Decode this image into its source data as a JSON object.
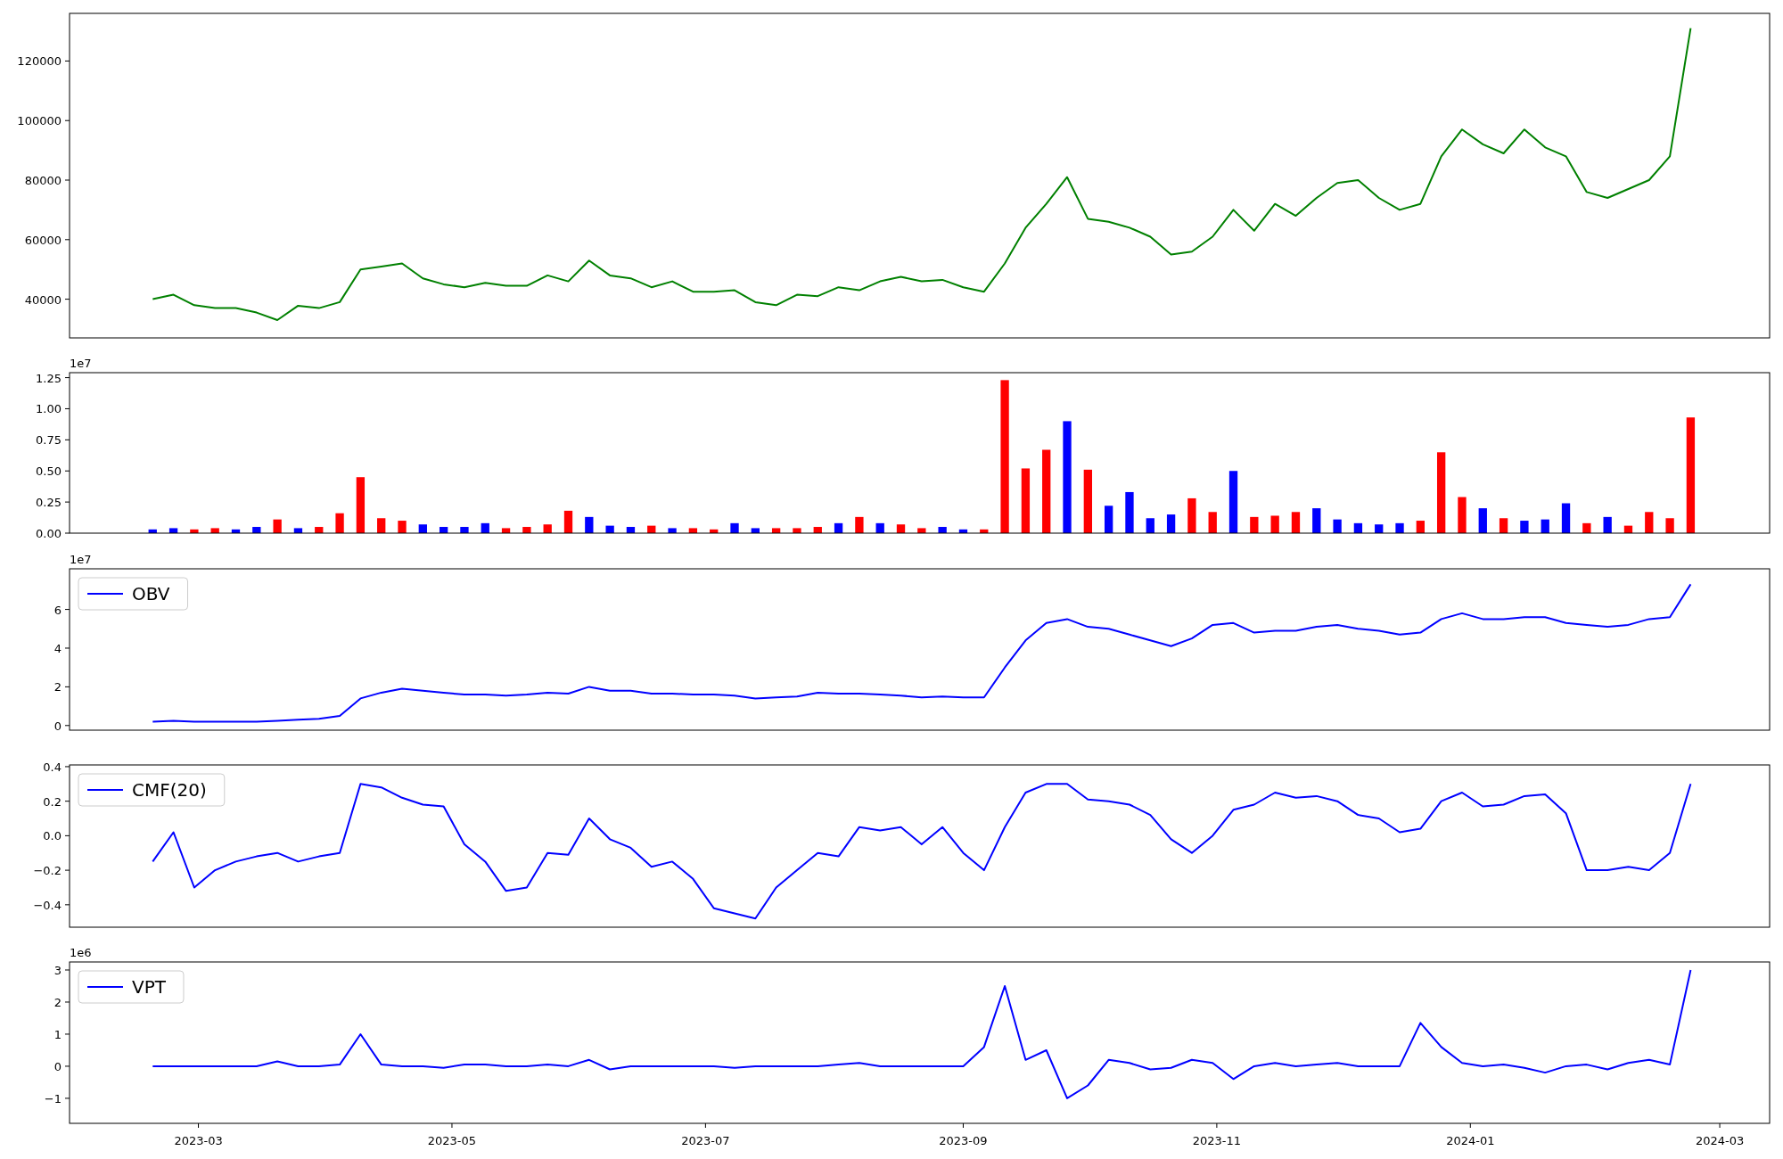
{
  "figure": {
    "panels": [
      {
        "chart_data": {
          "type": "line",
          "x": [
            "2023-02-18",
            "2023-02-23",
            "2023-02-28",
            "2023-03-05",
            "2023-03-10",
            "2023-03-15",
            "2023-03-20",
            "2023-03-25",
            "2023-03-30",
            "2023-04-04",
            "2023-04-09",
            "2023-04-14",
            "2023-04-19",
            "2023-04-24",
            "2023-04-29",
            "2023-05-04",
            "2023-05-09",
            "2023-05-14",
            "2023-05-19",
            "2023-05-24",
            "2023-05-29",
            "2023-06-03",
            "2023-06-08",
            "2023-06-13",
            "2023-06-18",
            "2023-06-23",
            "2023-06-28",
            "2023-07-03",
            "2023-07-08",
            "2023-07-13",
            "2023-07-18",
            "2023-07-23",
            "2023-07-28",
            "2023-08-02",
            "2023-08-07",
            "2023-08-12",
            "2023-08-17",
            "2023-08-22",
            "2023-08-27",
            "2023-09-01",
            "2023-09-06",
            "2023-09-11",
            "2023-09-16",
            "2023-09-21",
            "2023-09-26",
            "2023-10-01",
            "2023-10-06",
            "2023-10-11",
            "2023-10-16",
            "2023-10-21",
            "2023-10-26",
            "2023-10-31",
            "2023-11-05",
            "2023-11-10",
            "2023-11-15",
            "2023-11-20",
            "2023-11-25",
            "2023-11-30",
            "2023-12-05",
            "2023-12-10",
            "2023-12-15",
            "2023-12-20",
            "2023-12-25",
            "2023-12-30",
            "2024-01-04",
            "2024-01-09",
            "2024-01-14",
            "2024-01-19",
            "2024-01-24",
            "2024-01-29",
            "2024-02-03",
            "2024-02-08",
            "2024-02-13",
            "2024-02-18",
            "2024-02-23"
          ],
          "series": [
            {
              "color": "#008000",
              "values": [
                40000,
                41500,
                38000,
                37000,
                37000,
                35500,
                33000,
                37800,
                37000,
                39000,
                50000,
                51000,
                52000,
                47000,
                45000,
                44000,
                45500,
                44500,
                44500,
                48000,
                46000,
                53000,
                48000,
                47000,
                44000,
                46000,
                42500,
                42500,
                43000,
                39000,
                38000,
                41500,
                41000,
                44000,
                43000,
                46000,
                47500,
                46000,
                46500,
                44000,
                42500,
                52000,
                64000,
                72000,
                81000,
                67000,
                66000,
                64000,
                61000,
                55000,
                56000,
                61000,
                70000,
                63000,
                72000,
                68000,
                74000,
                79000,
                80000,
                74000,
                70000,
                72000,
                88000,
                97000,
                92000,
                89000,
                97000,
                91000,
                88000,
                76000,
                74000,
                77000,
                80000,
                88000,
                131000
              ]
            }
          ],
          "xlim": [
            "2023-01-29",
            "2024-03-13"
          ],
          "ylim": [
            27000,
            136000
          ],
          "yticks": [
            40000,
            60000,
            80000,
            100000,
            120000
          ]
        }
      },
      {
        "offset_text": "1e7",
        "chart_data": {
          "type": "bar",
          "x": [
            "2023-02-18",
            "2023-02-23",
            "2023-02-28",
            "2023-03-05",
            "2023-03-10",
            "2023-03-15",
            "2023-03-20",
            "2023-03-25",
            "2023-03-30",
            "2023-04-04",
            "2023-04-09",
            "2023-04-14",
            "2023-04-19",
            "2023-04-24",
            "2023-04-29",
            "2023-05-04",
            "2023-05-09",
            "2023-05-14",
            "2023-05-19",
            "2023-05-24",
            "2023-05-29",
            "2023-06-03",
            "2023-06-08",
            "2023-06-13",
            "2023-06-18",
            "2023-06-23",
            "2023-06-28",
            "2023-07-03",
            "2023-07-08",
            "2023-07-13",
            "2023-07-18",
            "2023-07-23",
            "2023-07-28",
            "2023-08-02",
            "2023-08-07",
            "2023-08-12",
            "2023-08-17",
            "2023-08-22",
            "2023-08-27",
            "2023-09-01",
            "2023-09-06",
            "2023-09-11",
            "2023-09-16",
            "2023-09-21",
            "2023-09-26",
            "2023-10-01",
            "2023-10-06",
            "2023-10-11",
            "2023-10-16",
            "2023-10-21",
            "2023-10-26",
            "2023-10-31",
            "2023-11-05",
            "2023-11-10",
            "2023-11-15",
            "2023-11-20",
            "2023-11-25",
            "2023-11-30",
            "2023-12-05",
            "2023-12-10",
            "2023-12-15",
            "2023-12-20",
            "2023-12-25",
            "2023-12-30",
            "2024-01-04",
            "2024-01-09",
            "2024-01-14",
            "2024-01-19",
            "2024-01-24",
            "2024-01-29",
            "2024-02-03",
            "2024-02-08",
            "2024-02-13",
            "2024-02-18",
            "2024-02-23"
          ],
          "series": [
            {
              "color": "#ff0000",
              "values": [
                null,
                null,
                0.03,
                0.04,
                null,
                null,
                0.11,
                null,
                0.05,
                0.16,
                0.45,
                0.12,
                0.1,
                null,
                null,
                null,
                null,
                0.04,
                0.05,
                0.07,
                0.18,
                null,
                null,
                null,
                0.06,
                null,
                0.04,
                0.03,
                null,
                null,
                0.04,
                0.04,
                0.05,
                null,
                0.13,
                null,
                0.07,
                0.04,
                null,
                null,
                0.03,
                1.23,
                0.52,
                0.67,
                null,
                0.51,
                null,
                null,
                null,
                null,
                0.28,
                0.17,
                null,
                0.13,
                0.14,
                0.17,
                null,
                null,
                null,
                null,
                null,
                0.1,
                0.65,
                0.29,
                null,
                0.12,
                null,
                null,
                null,
                0.08,
                null,
                0.06,
                0.17,
                0.12,
                0.93
              ]
            },
            {
              "color": "#0000ff",
              "values": [
                0.03,
                0.04,
                null,
                null,
                0.03,
                0.05,
                null,
                0.04,
                null,
                null,
                null,
                null,
                null,
                0.07,
                0.05,
                0.05,
                0.08,
                null,
                null,
                null,
                null,
                0.13,
                0.06,
                0.05,
                null,
                0.04,
                null,
                null,
                0.08,
                0.04,
                null,
                null,
                null,
                0.08,
                null,
                0.08,
                null,
                null,
                0.05,
                0.03,
                null,
                null,
                null,
                null,
                0.9,
                null,
                0.22,
                0.33,
                0.12,
                0.15,
                null,
                null,
                0.5,
                null,
                null,
                null,
                0.2,
                0.11,
                0.08,
                0.07,
                0.08,
                null,
                null,
                null,
                0.2,
                null,
                0.1,
                0.11,
                0.24,
                null,
                0.13,
                null,
                null,
                null,
                null
              ]
            }
          ],
          "xlim": [
            "2023-01-29",
            "2024-03-13"
          ],
          "ylim": [
            0,
            1.29
          ],
          "yticks": [
            {
              "value": 0,
              "label": "0.00"
            },
            {
              "value": 0.25,
              "label": "0.25"
            },
            {
              "value": 0.5,
              "label": "0.50"
            },
            {
              "value": 0.75,
              "label": "0.75"
            },
            {
              "value": 1,
              "label": "1.00"
            },
            {
              "value": 1.25,
              "label": "1.25"
            }
          ]
        }
      },
      {
        "offset_text": "1e7",
        "chart_data": {
          "type": "line",
          "x": [
            "2023-02-18",
            "2023-02-23",
            "2023-02-28",
            "2023-03-05",
            "2023-03-10",
            "2023-03-15",
            "2023-03-20",
            "2023-03-25",
            "2023-03-30",
            "2023-04-04",
            "2023-04-09",
            "2023-04-14",
            "2023-04-19",
            "2023-04-24",
            "2023-04-29",
            "2023-05-04",
            "2023-05-09",
            "2023-05-14",
            "2023-05-19",
            "2023-05-24",
            "2023-05-29",
            "2023-06-03",
            "2023-06-08",
            "2023-06-13",
            "2023-06-18",
            "2023-06-23",
            "2023-06-28",
            "2023-07-03",
            "2023-07-08",
            "2023-07-13",
            "2023-07-18",
            "2023-07-23",
            "2023-07-28",
            "2023-08-02",
            "2023-08-07",
            "2023-08-12",
            "2023-08-17",
            "2023-08-22",
            "2023-08-27",
            "2023-09-01",
            "2023-09-06",
            "2023-09-11",
            "2023-09-16",
            "2023-09-21",
            "2023-09-26",
            "2023-10-01",
            "2023-10-06",
            "2023-10-11",
            "2023-10-16",
            "2023-10-21",
            "2023-10-26",
            "2023-10-31",
            "2023-11-05",
            "2023-11-10",
            "2023-11-15",
            "2023-11-20",
            "2023-11-25",
            "2023-11-30",
            "2023-12-05",
            "2023-12-10",
            "2023-12-15",
            "2023-12-20",
            "2023-12-25",
            "2023-12-30",
            "2024-01-04",
            "2024-01-09",
            "2024-01-14",
            "2024-01-19",
            "2024-01-24",
            "2024-01-29",
            "2024-02-03",
            "2024-02-08",
            "2024-02-13",
            "2024-02-18",
            "2024-02-23"
          ],
          "series": [
            {
              "name": "OBV",
              "color": "#0000ff",
              "values": [
                0.2,
                0.25,
                0.2,
                0.2,
                0.2,
                0.2,
                0.25,
                0.3,
                0.35,
                0.5,
                1.4,
                1.7,
                1.9,
                1.8,
                1.7,
                1.6,
                1.6,
                1.55,
                1.6,
                1.7,
                1.65,
                2.0,
                1.8,
                1.8,
                1.65,
                1.65,
                1.6,
                1.6,
                1.55,
                1.4,
                1.45,
                1.5,
                1.7,
                1.65,
                1.65,
                1.6,
                1.55,
                1.45,
                1.5,
                1.45,
                1.45,
                3.0,
                4.4,
                5.3,
                5.5,
                5.1,
                5.0,
                4.7,
                4.4,
                4.1,
                4.5,
                5.2,
                5.3,
                4.8,
                4.9,
                4.9,
                5.1,
                5.2,
                5.0,
                4.9,
                4.7,
                4.8,
                5.5,
                5.8,
                5.5,
                5.5,
                5.6,
                5.6,
                5.3,
                5.2,
                5.1,
                5.2,
                5.5,
                5.6,
                7.3
              ]
            }
          ],
          "xlim": [
            "2023-01-29",
            "2024-03-13"
          ],
          "ylim": [
            -0.24,
            8.1
          ],
          "yticks": [
            0,
            2,
            4,
            6
          ]
        }
      },
      {
        "chart_data": {
          "type": "line",
          "x": [
            "2023-02-18",
            "2023-02-23",
            "2023-02-28",
            "2023-03-05",
            "2023-03-10",
            "2023-03-15",
            "2023-03-20",
            "2023-03-25",
            "2023-03-30",
            "2023-04-04",
            "2023-04-09",
            "2023-04-14",
            "2023-04-19",
            "2023-04-24",
            "2023-04-29",
            "2023-05-04",
            "2023-05-09",
            "2023-05-14",
            "2023-05-19",
            "2023-05-24",
            "2023-05-29",
            "2023-06-03",
            "2023-06-08",
            "2023-06-13",
            "2023-06-18",
            "2023-06-23",
            "2023-06-28",
            "2023-07-03",
            "2023-07-08",
            "2023-07-13",
            "2023-07-18",
            "2023-07-23",
            "2023-07-28",
            "2023-08-02",
            "2023-08-07",
            "2023-08-12",
            "2023-08-17",
            "2023-08-22",
            "2023-08-27",
            "2023-09-01",
            "2023-09-06",
            "2023-09-11",
            "2023-09-16",
            "2023-09-21",
            "2023-09-26",
            "2023-10-01",
            "2023-10-06",
            "2023-10-11",
            "2023-10-16",
            "2023-10-21",
            "2023-10-26",
            "2023-10-31",
            "2023-11-05",
            "2023-11-10",
            "2023-11-15",
            "2023-11-20",
            "2023-11-25",
            "2023-11-30",
            "2023-12-05",
            "2023-12-10",
            "2023-12-15",
            "2023-12-20",
            "2023-12-25",
            "2023-12-30",
            "2024-01-04",
            "2024-01-09",
            "2024-01-14",
            "2024-01-19",
            "2024-01-24",
            "2024-01-29",
            "2024-02-03",
            "2024-02-08",
            "2024-02-13",
            "2024-02-18",
            "2024-02-23"
          ],
          "series": [
            {
              "name": "CMF(20)",
              "color": "#0000ff",
              "values": [
                -0.15,
                0.02,
                -0.3,
                -0.2,
                -0.15,
                -0.12,
                -0.1,
                -0.15,
                -0.12,
                -0.1,
                0.3,
                0.28,
                0.22,
                0.18,
                0.17,
                -0.05,
                -0.15,
                -0.32,
                -0.3,
                -0.1,
                -0.11,
                0.1,
                -0.02,
                -0.07,
                -0.18,
                -0.15,
                -0.25,
                -0.42,
                -0.45,
                -0.48,
                -0.3,
                -0.2,
                -0.1,
                -0.12,
                0.05,
                0.03,
                0.05,
                -0.05,
                0.05,
                -0.1,
                -0.2,
                0.05,
                0.25,
                0.3,
                0.3,
                0.21,
                0.2,
                0.18,
                0.12,
                -0.02,
                -0.1,
                0.0,
                0.15,
                0.18,
                0.25,
                0.22,
                0.23,
                0.2,
                0.12,
                0.1,
                0.02,
                0.04,
                0.2,
                0.25,
                0.17,
                0.18,
                0.23,
                0.24,
                0.13,
                -0.2,
                -0.2,
                -0.18,
                -0.2,
                -0.1,
                0.3
              ]
            }
          ],
          "xlim": [
            "2023-01-29",
            "2024-03-13"
          ],
          "ylim": [
            -0.53,
            0.41
          ],
          "yticks": [
            {
              "value": -0.4,
              "label": "−0.4"
            },
            {
              "value": -0.2,
              "label": "−0.2"
            },
            {
              "value": 0,
              "label": "0.0"
            },
            {
              "value": 0.2,
              "label": "0.2"
            },
            {
              "value": 0.4,
              "label": "0.4"
            }
          ]
        }
      },
      {
        "offset_text": "1e6",
        "chart_data": {
          "type": "line",
          "x": [
            "2023-02-18",
            "2023-02-23",
            "2023-02-28",
            "2023-03-05",
            "2023-03-10",
            "2023-03-15",
            "2023-03-20",
            "2023-03-25",
            "2023-03-30",
            "2023-04-04",
            "2023-04-09",
            "2023-04-14",
            "2023-04-19",
            "2023-04-24",
            "2023-04-29",
            "2023-05-04",
            "2023-05-09",
            "2023-05-14",
            "2023-05-19",
            "2023-05-24",
            "2023-05-29",
            "2023-06-03",
            "2023-06-08",
            "2023-06-13",
            "2023-06-18",
            "2023-06-23",
            "2023-06-28",
            "2023-07-03",
            "2023-07-08",
            "2023-07-13",
            "2023-07-18",
            "2023-07-23",
            "2023-07-28",
            "2023-08-02",
            "2023-08-07",
            "2023-08-12",
            "2023-08-17",
            "2023-08-22",
            "2023-08-27",
            "2023-09-01",
            "2023-09-06",
            "2023-09-11",
            "2023-09-16",
            "2023-09-21",
            "2023-09-26",
            "2023-10-01",
            "2023-10-06",
            "2023-10-11",
            "2023-10-16",
            "2023-10-21",
            "2023-10-26",
            "2023-10-31",
            "2023-11-05",
            "2023-11-10",
            "2023-11-15",
            "2023-11-20",
            "2023-11-25",
            "2023-11-30",
            "2023-12-05",
            "2023-12-10",
            "2023-12-15",
            "2023-12-20",
            "2023-12-25",
            "2023-12-30",
            "2024-01-04",
            "2024-01-09",
            "2024-01-14",
            "2024-01-19",
            "2024-01-24",
            "2024-01-29",
            "2024-02-03",
            "2024-02-08",
            "2024-02-13",
            "2024-02-18",
            "2024-02-23"
          ],
          "series": [
            {
              "name": "VPT",
              "color": "#0000ff",
              "values": [
                0,
                0,
                0,
                0,
                0,
                0,
                0.15,
                0,
                0,
                0.05,
                1.0,
                0.05,
                0,
                0,
                -0.05,
                0.05,
                0.05,
                0,
                0,
                0.05,
                0,
                0.2,
                -0.1,
                0,
                0,
                0,
                0,
                0,
                -0.05,
                0,
                0,
                0,
                0,
                0.05,
                0.1,
                0,
                0,
                0,
                0,
                0,
                0.6,
                2.5,
                0.2,
                0.5,
                -1.0,
                -0.6,
                0.2,
                0.1,
                -0.1,
                -0.05,
                0.2,
                0.1,
                -0.4,
                0,
                0.1,
                0,
                0.05,
                0.1,
                0,
                0,
                0,
                1.35,
                0.6,
                0.1,
                0,
                0.05,
                -0.05,
                -0.2,
                0,
                0.05,
                -0.1,
                0.1,
                0.2,
                0.05,
                3.0
              ]
            }
          ],
          "xlim": [
            "2023-01-29",
            "2024-03-13"
          ],
          "ylim": [
            -1.78,
            3.25
          ],
          "yticks": [
            {
              "value": -1,
              "label": "−1"
            },
            {
              "value": 0,
              "label": "0"
            },
            {
              "value": 1,
              "label": "1"
            },
            {
              "value": 2,
              "label": "2"
            },
            {
              "value": 3,
              "label": "3"
            }
          ],
          "xticks": [
            {
              "value": "2023-03-01",
              "label": "2023-03"
            },
            {
              "value": "2023-05-01",
              "label": "2023-05"
            },
            {
              "value": "2023-07-01",
              "label": "2023-07"
            },
            {
              "value": "2023-09-01",
              "label": "2023-09"
            },
            {
              "value": "2023-11-01",
              "label": "2023-11"
            },
            {
              "value": "2024-01-01",
              "label": "2024-01"
            },
            {
              "value": "2024-03-01",
              "label": "2024-03"
            }
          ]
        }
      }
    ]
  }
}
